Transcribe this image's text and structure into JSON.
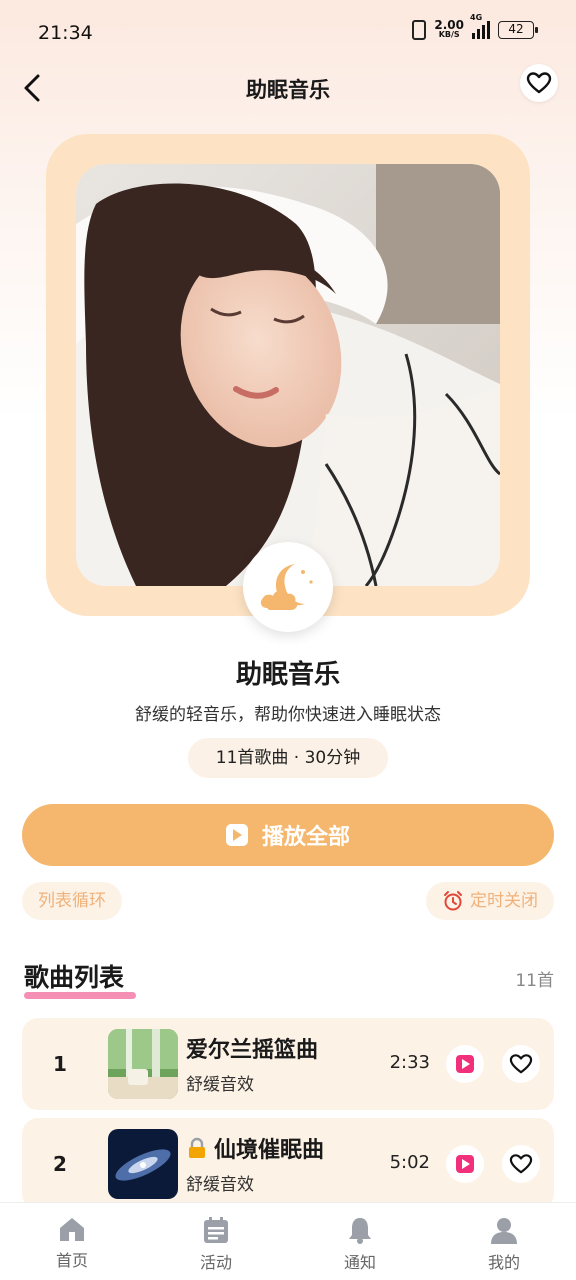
{
  "status_bar": {
    "time": "21:34",
    "speed_value": "2.00",
    "speed_unit": "KB/S",
    "network": "4G",
    "battery": "42"
  },
  "header": {
    "title": "助眠音乐",
    "back_icon": "chevron-left-icon",
    "favorite_icon": "heart-outline-icon"
  },
  "album": {
    "cover_icon": "moon-cloud-icon",
    "title": "助眠音乐",
    "description": "舒缓的轻音乐，帮助你快速进入睡眠状态",
    "meta": "11首歌曲 · 30分钟"
  },
  "actions": {
    "play_all_label": "播放全部",
    "loop_label": "列表循环",
    "timer_label": "定时关闭",
    "timer_icon": "alarm-clock-icon"
  },
  "songs_section": {
    "title": "歌曲列表",
    "count": "11首"
  },
  "songs": [
    {
      "index": "1",
      "name": "爱尔兰摇篮曲",
      "artist": "舒缓音效",
      "duration": "2:33",
      "locked": false
    },
    {
      "index": "2",
      "name": "仙境催眠曲",
      "artist": "舒缓音效",
      "duration": "5:02",
      "locked": true
    }
  ],
  "tabbar": [
    {
      "label": "首页",
      "icon": "home-icon"
    },
    {
      "label": "活动",
      "icon": "calendar-icon"
    },
    {
      "label": "通知",
      "icon": "bell-icon"
    },
    {
      "label": "我的",
      "icon": "user-icon"
    }
  ],
  "colors": {
    "accent": "#f4b76d",
    "pink": "#f0307a",
    "cream": "#fdf2e6",
    "frame": "#fde3c4"
  }
}
